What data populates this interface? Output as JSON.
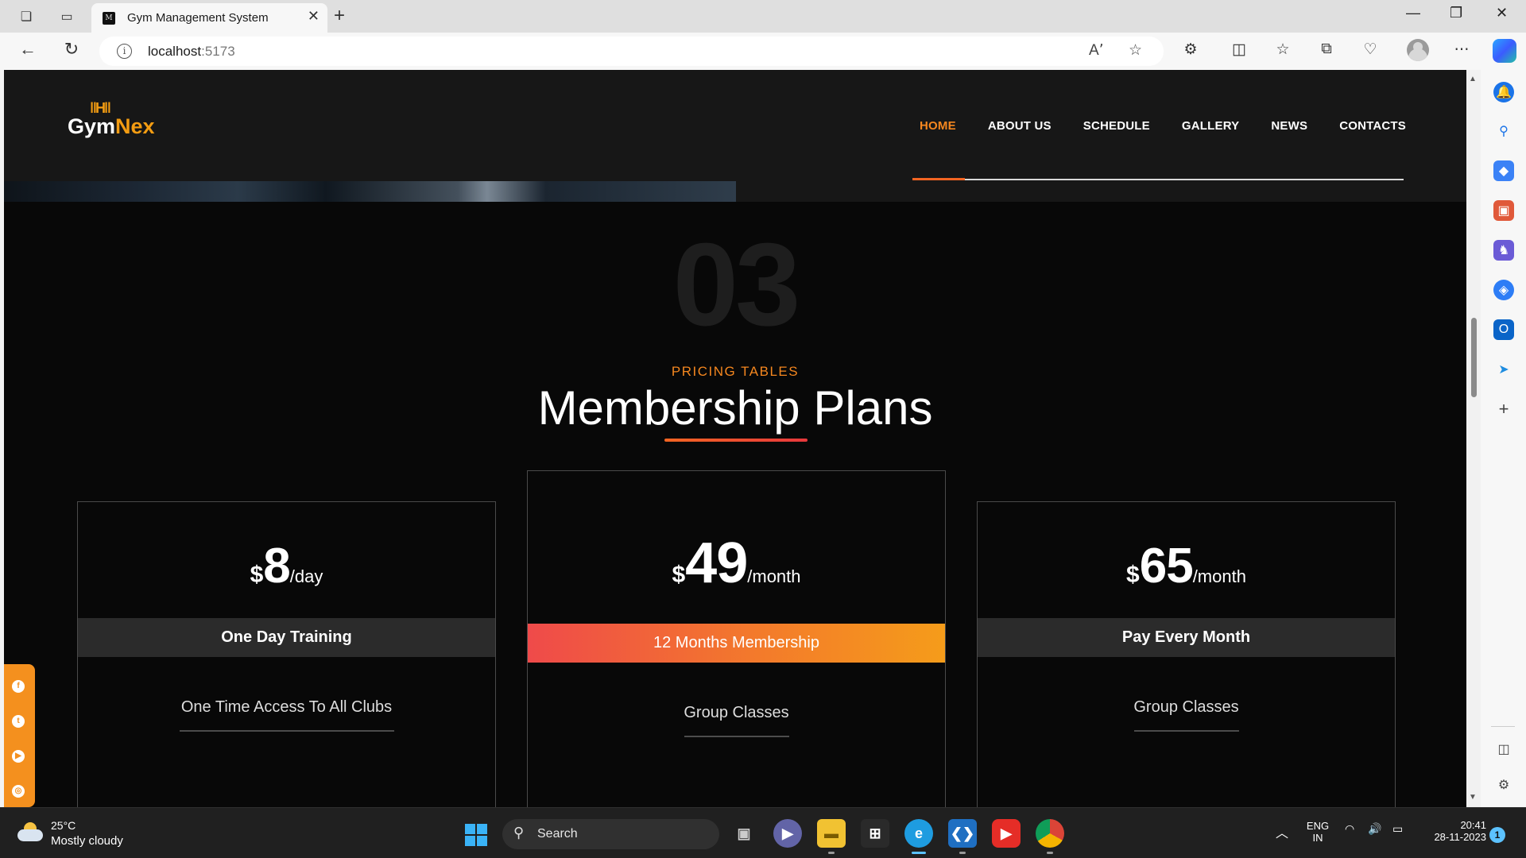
{
  "browser": {
    "tab_title": "Gym Management System",
    "url_host": "localhost",
    "url_port": ":5173"
  },
  "site": {
    "logo_part1": "Gym",
    "logo_part2": "Nex",
    "nav": [
      "HOME",
      "ABOUT US",
      "SCHEDULE",
      "GALLERY",
      "NEWS",
      "CONTACTS"
    ],
    "active_nav": "HOME"
  },
  "section": {
    "number": "03",
    "subtitle": "PRICING TABLES",
    "title": "Membership Plans"
  },
  "plans": [
    {
      "currency": "$",
      "amount": "8",
      "period": "/day",
      "name": "One Day Training",
      "feature": "One Time Access To All Clubs",
      "highlight": false
    },
    {
      "currency": "$",
      "amount": "49",
      "period": "/month",
      "name": "12 Months Membership",
      "feature": "Group Classes",
      "highlight": true
    },
    {
      "currency": "$",
      "amount": "65",
      "period": "/month",
      "name": "Pay Every Month",
      "feature": "Group Classes",
      "highlight": false
    }
  ],
  "social_icons": [
    "facebook-icon",
    "twitter-icon",
    "youtube-icon",
    "instagram-icon"
  ],
  "taskbar": {
    "temperature": "25°C",
    "weather": "Mostly cloudy",
    "search_label": "Search",
    "lang_line1": "ENG",
    "lang_line2": "IN",
    "time": "20:41",
    "date": "28-11-2023",
    "notification_count": "1"
  },
  "colors": {
    "accent_orange": "#f5871f",
    "gradient_red": "#ef4a4a",
    "page_bg": "#080808"
  }
}
